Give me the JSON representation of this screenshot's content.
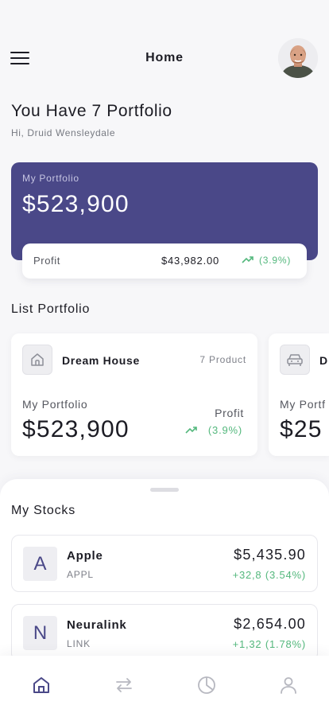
{
  "header": {
    "title": "Home",
    "menu_icon": "hamburger-menu-icon",
    "avatar_icon": "user-avatar"
  },
  "greeting": {
    "title": "You Have 7 Portfolio",
    "subtitle": "Hi, Druid Wensleydale"
  },
  "portfolio_card": {
    "label": "My Portfolio",
    "value": "$523,900",
    "profit_label": "Profit",
    "profit_value": "$43,982.00",
    "profit_pct": "(3.9%)",
    "accent": "#4a4888",
    "positive_color": "#54b87d"
  },
  "list_portfolio": {
    "title": "List Portfolio",
    "items": [
      {
        "name": "Dream House",
        "count": "7 Product",
        "icon": "house-icon",
        "label": "My Portfolio",
        "value": "$523,900",
        "profit_label": "Profit",
        "profit_pct": "(3.9%)"
      },
      {
        "name": "D",
        "icon": "car-icon",
        "label": "My Portf",
        "value": "$25"
      }
    ]
  },
  "stocks": {
    "title": "My Stocks",
    "items": [
      {
        "letter": "A",
        "name": "Apple",
        "ticker": "APPL",
        "price": "$5,435.90",
        "change": "+32,8 (3.54%)"
      },
      {
        "letter": "N",
        "name": "Neuralink",
        "ticker": "LINK",
        "price": "$2,654.00",
        "change": "+1,32 (1.78%)"
      }
    ]
  },
  "tabbar": {
    "tabs": [
      {
        "icon": "home-icon",
        "active": true
      },
      {
        "icon": "transfer-icon",
        "active": false
      },
      {
        "icon": "pie-chart-icon",
        "active": false
      },
      {
        "icon": "profile-icon",
        "active": false
      }
    ]
  }
}
